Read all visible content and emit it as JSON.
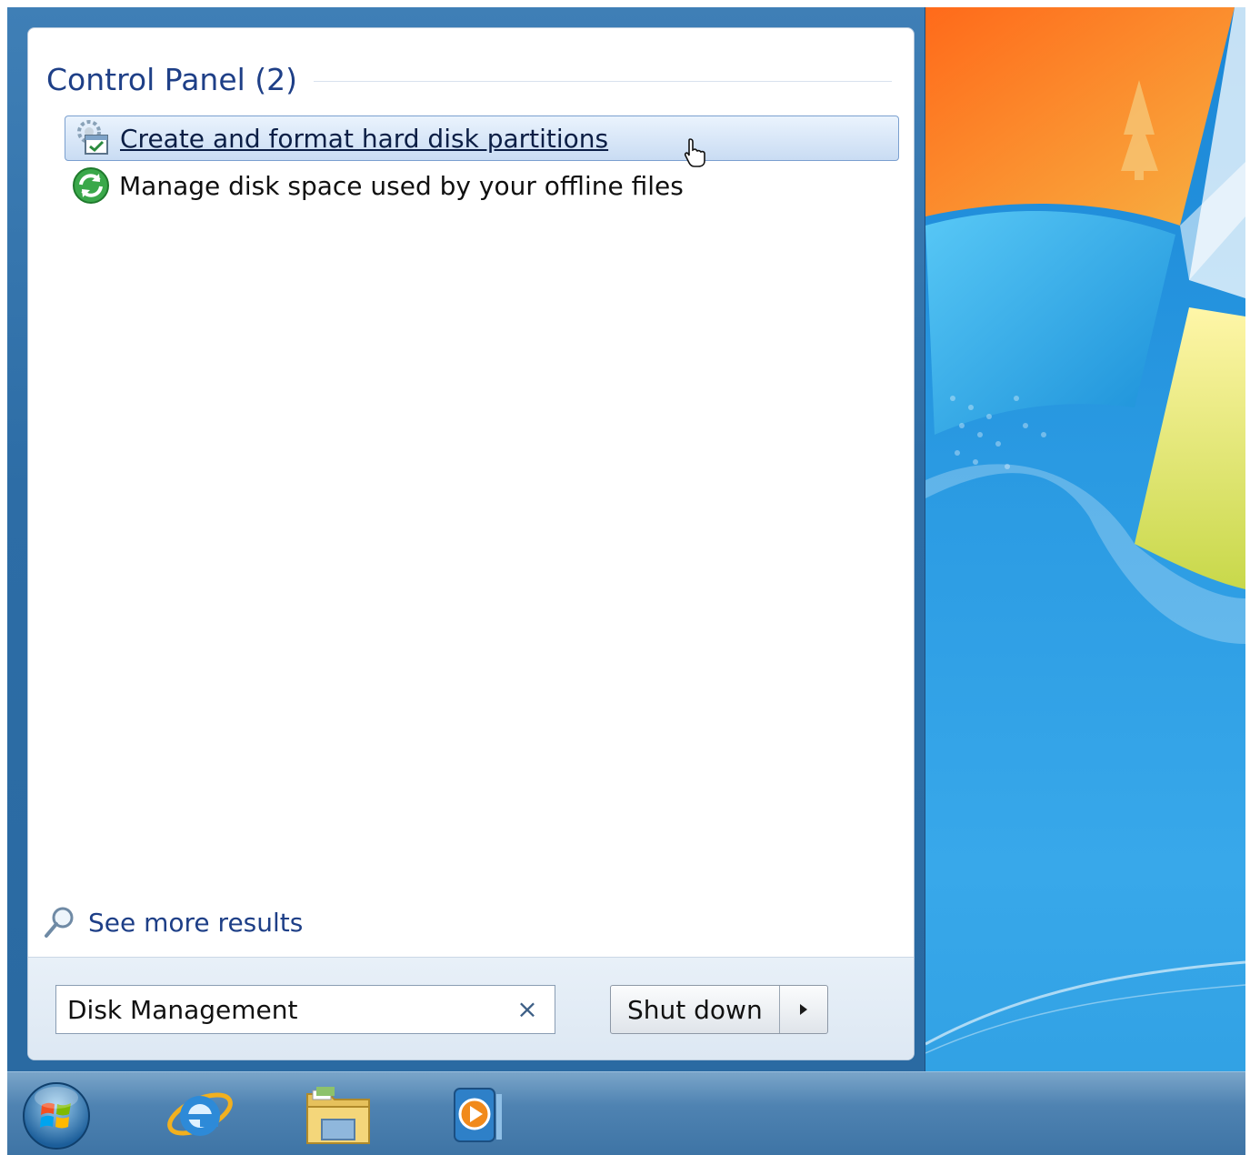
{
  "start_menu": {
    "group_title": "Control Panel (2)",
    "results": [
      {
        "label": "Create and format hard disk partitions",
        "icon": "disk-management-icon",
        "selected": true
      },
      {
        "label": "Manage disk space used by your offline files",
        "icon": "sync-center-icon",
        "selected": false
      }
    ],
    "see_more_label": "See more results",
    "search": {
      "value": "Disk Management",
      "clear_glyph": "×"
    },
    "shutdown_label": "Shut down"
  },
  "taskbar": {
    "items": [
      "start-orb",
      "internet-explorer-icon",
      "windows-explorer-icon",
      "windows-media-player-icon"
    ]
  },
  "colors": {
    "accent": "#1e3f87",
    "selection": "#c9dcf3",
    "taskbar": "#4f83b2",
    "desktop": "#2a9ae2"
  }
}
